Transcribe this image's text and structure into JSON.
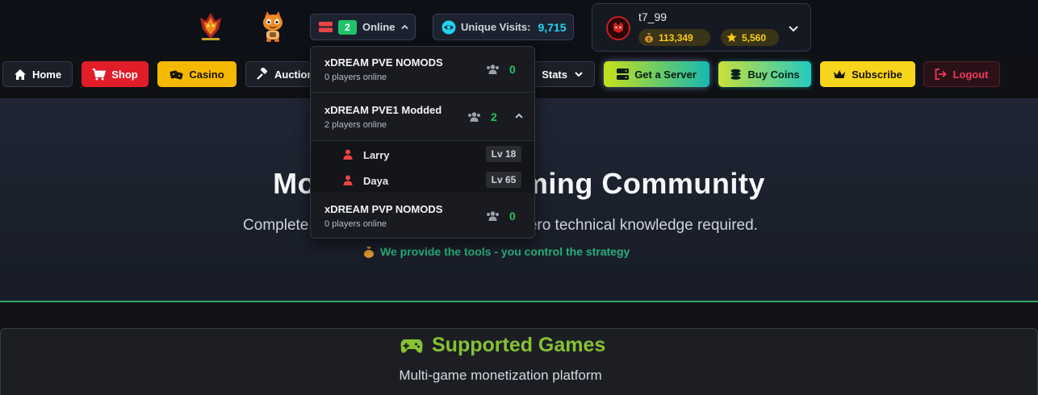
{
  "header": {
    "online_label": "Online",
    "online_count": "2",
    "visits_label": "Unique Visits:",
    "visits_value": "9,715",
    "user": {
      "name": "t7_99",
      "money": "113,349",
      "stars": "5,560"
    }
  },
  "nav": {
    "home": "Home",
    "shop": "Shop",
    "casino": "Casino",
    "auction": "Auction",
    "stats": "Stats",
    "get_server": "Get a Server",
    "buy_coins": "Buy Coins",
    "subscribe": "Subscribe",
    "logout": "Logout"
  },
  "dropdown": {
    "servers": [
      {
        "name": "xDREAM PVE NOMODS",
        "players_text": "0 players online",
        "count": "0"
      },
      {
        "name": "xDREAM PVE1 Modded",
        "players_text": "2 players online",
        "count": "2"
      },
      {
        "name": "xDREAM PVP NOMODS",
        "players_text": "0 players online",
        "count": "0"
      }
    ],
    "players": [
      {
        "name": "Larry",
        "level": "Lv 18"
      },
      {
        "name": "Daya",
        "level": "Lv 65"
      }
    ]
  },
  "hero": {
    "title": "Monetize Your Gaming Community",
    "subtitle": "Complete monetization with full support. Zero technical knowledge required.",
    "tagline": "We provide the tools - you control the strategy"
  },
  "games": {
    "title": "Supported Games",
    "subtitle": "Multi-game monetization platform"
  },
  "colors": {
    "accent_green": "#22c55e",
    "accent_cyan": "#22d3ee",
    "gold": "#facc15",
    "shop_red": "#e11d2a",
    "casino_yellow": "#f5b800",
    "games_green": "#86c232"
  }
}
